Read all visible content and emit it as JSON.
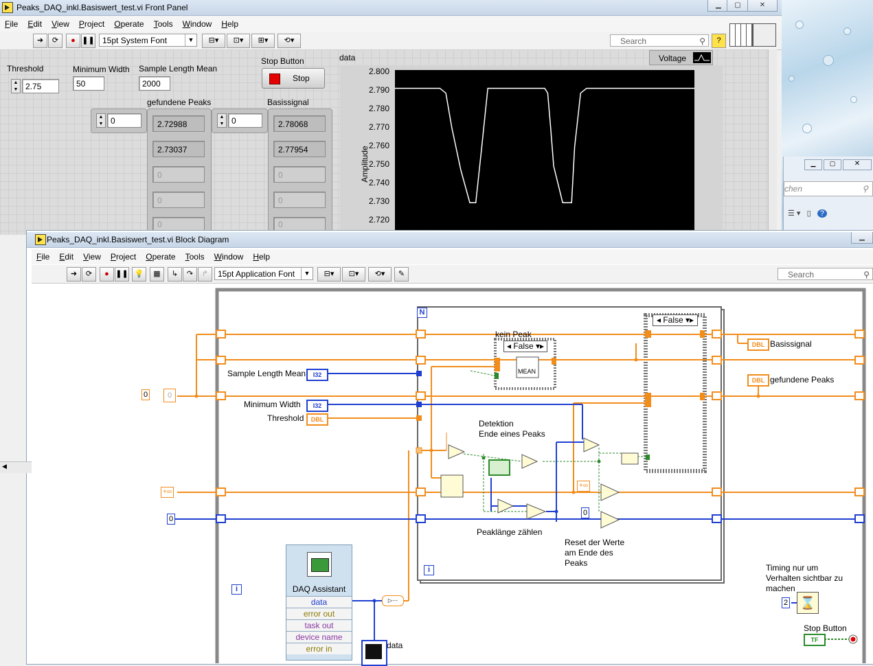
{
  "front_panel": {
    "title": "Peaks_DAQ_inkl.Basiswert_test.vi Front Panel",
    "menu": [
      "File",
      "Edit",
      "View",
      "Project",
      "Operate",
      "Tools",
      "Window",
      "Help"
    ],
    "font_selector": "15pt System Font",
    "search_placeholder": "Search",
    "controls": {
      "threshold_label": "Threshold",
      "threshold_value": "2.75",
      "min_width_label": "Minimum Width",
      "min_width_value": "50",
      "sample_length_label": "Sample Length Mean",
      "sample_length_value": "2000",
      "stop_label": "Stop Button",
      "stop_text": "Stop"
    },
    "peaks": {
      "label": "gefundene Peaks",
      "index": "0",
      "values": [
        "2.72988",
        "2.73037",
        "0",
        "0",
        "0"
      ]
    },
    "basis": {
      "label": "Basissignal",
      "index": "0",
      "values": [
        "2.78068",
        "2.77954",
        "0",
        "0",
        "0"
      ]
    },
    "graph": {
      "label": "data",
      "legend": "Voltage",
      "ylabel": "Amplitude",
      "yticks": [
        "2.800",
        "2.790",
        "2.780",
        "2.770",
        "2.760",
        "2.750",
        "2.740",
        "2.730",
        "2.720"
      ]
    }
  },
  "chart_data": {
    "type": "line",
    "title": "data",
    "ylabel": "Amplitude",
    "ylim": [
      2.715,
      2.8
    ],
    "series": [
      {
        "name": "Voltage",
        "x": [
          0,
          15,
          17,
          19,
          22,
          25,
          27,
          29,
          31,
          50,
          51,
          52,
          53,
          56,
          59,
          60,
          62,
          64,
          80,
          100
        ],
        "values": [
          2.7905,
          2.7905,
          2.788,
          2.77,
          2.748,
          2.731,
          2.731,
          2.76,
          2.7905,
          2.7905,
          2.788,
          2.77,
          2.75,
          2.731,
          2.731,
          2.76,
          2.788,
          2.7905,
          2.7905,
          2.7905
        ]
      }
    ]
  },
  "block_diagram": {
    "title": "Peaks_DAQ_inkl.Basiswert_test.vi Block Diagram",
    "menu": [
      "File",
      "Edit",
      "View",
      "Project",
      "Operate",
      "Tools",
      "Window",
      "Help"
    ],
    "font_selector": "15pt Application Font",
    "search_placeholder": "Search",
    "labels": {
      "sample_length_mean": "Sample Length Mean",
      "minimum_width": "Minimum Width",
      "threshold": "Threshold",
      "basissignal": "Basissignal",
      "gefundene_peaks": "gefundene Peaks",
      "kein_peak": "kein Peak",
      "case_false_inner": "False",
      "case_false_outer": "False",
      "mean": "MEAN",
      "detektion": "Detektion",
      "ende_eines_peaks": "Ende eines Peaks",
      "peaklaenge": "Peaklänge zählen",
      "reset1": "Reset der Werte",
      "reset2": "am Ende des",
      "reset3": "Peaks",
      "timing1": "Timing nur um",
      "timing2": "Verhalten sichtbar zu",
      "timing3": "machen",
      "stop_button": "Stop Button",
      "data": "data",
      "n": "N",
      "i": "i",
      "i2": "i",
      "i3": "i"
    },
    "types": {
      "i32": "I32",
      "i32b": "I32",
      "dbl": "DBL",
      "dbl_basis": "DBL",
      "dbl_peaks": "DBL",
      "tf": "TF"
    },
    "constants": {
      "zero_a": "0",
      "zero_b": "0",
      "zero_c": "0",
      "inf_a": "+∞",
      "inf_b": "+∞",
      "two": "2"
    },
    "daq": {
      "title": "DAQ Assistant",
      "outputs": [
        "data",
        "error out",
        "task out",
        "device name",
        "error in"
      ]
    }
  },
  "colors": {
    "orange_wire": "#f28c1a",
    "blue_wire": "#1f3fd1",
    "green_wire": "#2a8a2a",
    "plot_bg": "#000000"
  },
  "icons": [
    "vi-icon",
    "run-arrow-icon",
    "run-continuously-icon",
    "abort-icon",
    "pause-icon",
    "highlight-execution-icon",
    "search-icon",
    "help-icon",
    "daq-assistant-icon",
    "wait-icon",
    "stop-led-icon"
  ]
}
